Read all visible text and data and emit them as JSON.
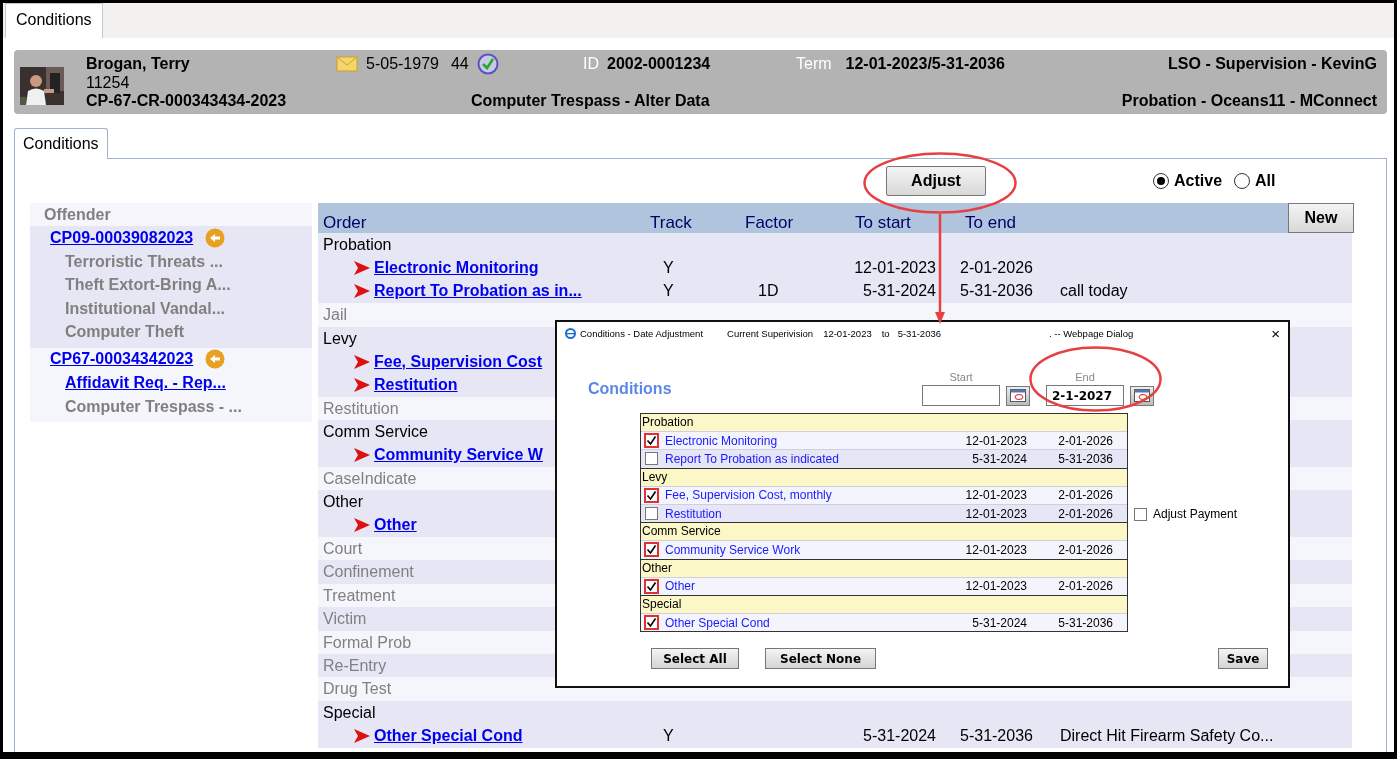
{
  "tabs": [
    {
      "label": "Conditions",
      "selected": true
    }
  ],
  "header": {
    "name": "Brogan, Terry",
    "number": "11254",
    "case": "CP-67-CR-000343434-2023",
    "dob": "5-05-1979",
    "age": "44",
    "id_label": "ID",
    "id": "2002-0001234",
    "term_label": "Term",
    "term": "12-01-2023/5-31-2036",
    "offense": "Computer Trespass - Alter Data",
    "office": "LSO - Supervision - KevinG",
    "program": "Probation - Oceans11 - MConnect"
  },
  "section_tabs": [
    {
      "label": "Conditions",
      "selected": true
    }
  ],
  "adjust_button": "Adjust",
  "filter": [
    {
      "label": "Active",
      "selected": true
    },
    {
      "label": "All",
      "selected": false
    }
  ],
  "offender_panel": {
    "title": "Offender",
    "cases": [
      {
        "case": "CP09-00039082023",
        "charges": [
          {
            "text": "Terroristic Threats ...",
            "kind": "text"
          },
          {
            "text": "Theft Extort-Bring A...",
            "kind": "text"
          },
          {
            "text": "Institutional Vandal...",
            "kind": "text"
          },
          {
            "text": "Computer Theft",
            "kind": "text"
          }
        ]
      },
      {
        "case": "CP67-00034342023",
        "charges": [
          {
            "text": "Affidavit Req. - Rep...",
            "kind": "link"
          },
          {
            "text": "Computer Trespass - ...",
            "kind": "text"
          }
        ]
      }
    ]
  },
  "orders_table": {
    "columns": [
      "Order",
      "Track",
      "Factor",
      "To start",
      "To end"
    ],
    "new_button": "New",
    "groups": [
      {
        "name": "Probation",
        "active": true,
        "orders": [
          {
            "name": "Electronic Monitoring",
            "track": "Y",
            "start": "12-01-2023",
            "end": "2-01-2026"
          },
          {
            "name": "Report To Probation as in...",
            "track": "Y",
            "factor": "1D",
            "start": "5-31-2024",
            "end": "5-31-2036",
            "note": "call today"
          }
        ]
      },
      {
        "name": "Jail",
        "active": false
      },
      {
        "name": "Levy",
        "active": true,
        "orders": [
          {
            "name": "Fee, Supervision Cost"
          },
          {
            "name": "Restitution"
          }
        ]
      },
      {
        "name": "Restitution",
        "active": false
      },
      {
        "name": "Comm Service",
        "active": true,
        "orders": [
          {
            "name": "Community Service W"
          }
        ]
      },
      {
        "name": "CaseIndicate",
        "active": false
      },
      {
        "name": "Other",
        "active": true,
        "orders": [
          {
            "name": "Other"
          }
        ]
      },
      {
        "name": "Court",
        "active": false
      },
      {
        "name": "Confinement",
        "active": false
      },
      {
        "name": "Treatment",
        "active": false
      },
      {
        "name": "Victim",
        "active": false
      },
      {
        "name": "Formal Prob",
        "active": false
      },
      {
        "name": "Re-Entry",
        "active": false
      },
      {
        "name": "Drug Test",
        "active": false
      },
      {
        "name": "Special",
        "active": true,
        "orders": [
          {
            "name": "Other Special Cond",
            "track": "Y",
            "start": "5-31-2024",
            "end": "5-31-2036",
            "note": "Direct Hit Firearm Safety Co..."
          }
        ]
      }
    ]
  },
  "dialog": {
    "title": "Conditions - Date Adjustment",
    "supervision_label": "Current Superivision",
    "supervision_start": "12-01-2023",
    "to": "to",
    "supervision_end": "5-31-2036",
    "title_suffix": ". -- Webpage Dialog",
    "close": "×",
    "heading": "Conditions",
    "start_label": "Start",
    "end_label": "End",
    "end_value": "2-1-2027",
    "groups": [
      {
        "name": "Probation",
        "items": [
          {
            "name": "Electronic Monitoring",
            "checked": true,
            "start": "12-01-2023",
            "end": "2-01-2026"
          },
          {
            "name": "Report To Probation as indicated",
            "checked": false,
            "start": "5-31-2024",
            "end": "5-31-2036"
          }
        ]
      },
      {
        "name": "Levy",
        "items": [
          {
            "name": "Fee, Supervision Cost, monthly",
            "checked": true,
            "start": "12-01-2023",
            "end": "2-01-2026"
          },
          {
            "name": "Restitution",
            "checked": false,
            "start": "12-01-2023",
            "end": "2-01-2026"
          }
        ]
      },
      {
        "name": "Comm Service",
        "items": [
          {
            "name": "Community Service Work",
            "checked": true,
            "start": "12-01-2023",
            "end": "2-01-2026"
          }
        ]
      },
      {
        "name": "Other",
        "items": [
          {
            "name": "Other",
            "checked": true,
            "start": "12-01-2023",
            "end": "2-01-2026"
          }
        ]
      },
      {
        "name": "Special",
        "items": [
          {
            "name": "Other Special Cond",
            "checked": true,
            "start": "5-31-2024",
            "end": "5-31-2036"
          }
        ]
      }
    ],
    "adjust_payment": {
      "label": "Adjust Payment",
      "checked": false
    },
    "buttons": [
      "Select All",
      "Select None",
      "Save"
    ]
  }
}
